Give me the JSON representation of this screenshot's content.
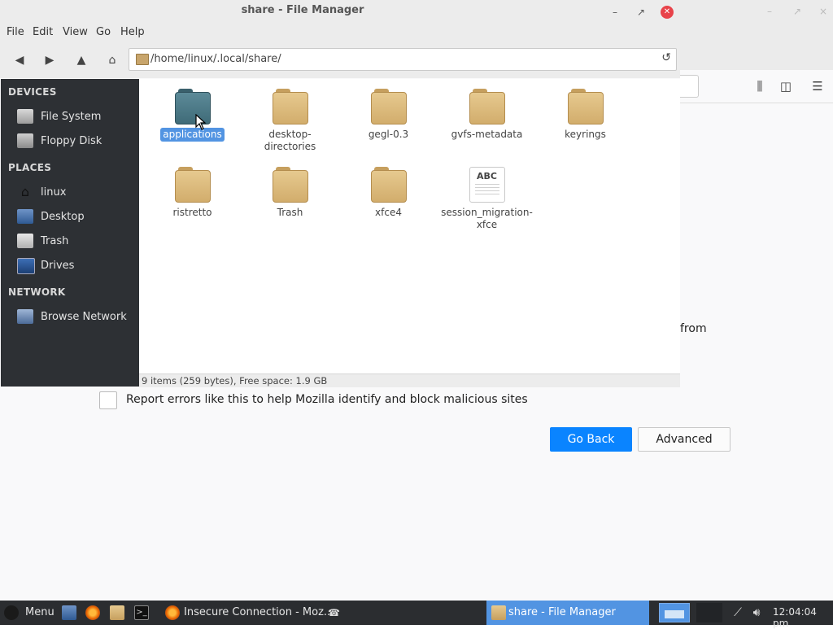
{
  "file_manager": {
    "title": "share - File Manager",
    "menu": [
      "File",
      "Edit",
      "View",
      "Go",
      "Help"
    ],
    "location_path": "/home/linux/.local/share/",
    "sidebar": {
      "devices_header": "DEVICES",
      "devices": [
        {
          "label": "File System",
          "icon": "harddrive-icon"
        },
        {
          "label": "Floppy Disk",
          "icon": "floppy-icon"
        }
      ],
      "places_header": "PLACES",
      "places": [
        {
          "label": "linux",
          "icon": "home-icon"
        },
        {
          "label": "Desktop",
          "icon": "desktop-icon"
        },
        {
          "label": "Trash",
          "icon": "trash-icon"
        },
        {
          "label": "Drives",
          "icon": "drives-icon"
        }
      ],
      "network_header": "NETWORK",
      "network": [
        {
          "label": "Browse Network",
          "icon": "network-icon"
        }
      ]
    },
    "items": [
      {
        "label": "applications",
        "type": "folder",
        "selected": true
      },
      {
        "label": "desktop-directories",
        "label_line1": "desktop-",
        "label_line2": "directories",
        "type": "folder"
      },
      {
        "label": "gegl-0.3",
        "type": "folder"
      },
      {
        "label": "gvfs-metadata",
        "type": "folder"
      },
      {
        "label": "keyrings",
        "type": "folder"
      },
      {
        "label": "ristretto",
        "type": "folder"
      },
      {
        "label": "Trash",
        "type": "folder"
      },
      {
        "label": "xfce4",
        "type": "folder"
      },
      {
        "label": "session_migration-xfce",
        "label_line1": "session_migration-",
        "label_line2": "xfce",
        "type": "text-file",
        "icon_text": "ABC"
      }
    ],
    "status": "9 items (259 bytes), Free space: 1.9 GB"
  },
  "browser_background": {
    "partial_text": "from",
    "report_checkbox_label": "Report errors like this to help Mozilla identify and block malicious sites",
    "go_back_label": "Go Back",
    "advanced_label": "Advanced",
    "accent_color": "#0a84ff"
  },
  "taskbar": {
    "menu_label": "Menu",
    "tasks": [
      {
        "label": "Insecure Connection - Moz..."
      },
      {
        "label": "share - File Manager",
        "active": true
      }
    ],
    "clock": "12:04:04 pm",
    "active_color": "#5294e2"
  }
}
